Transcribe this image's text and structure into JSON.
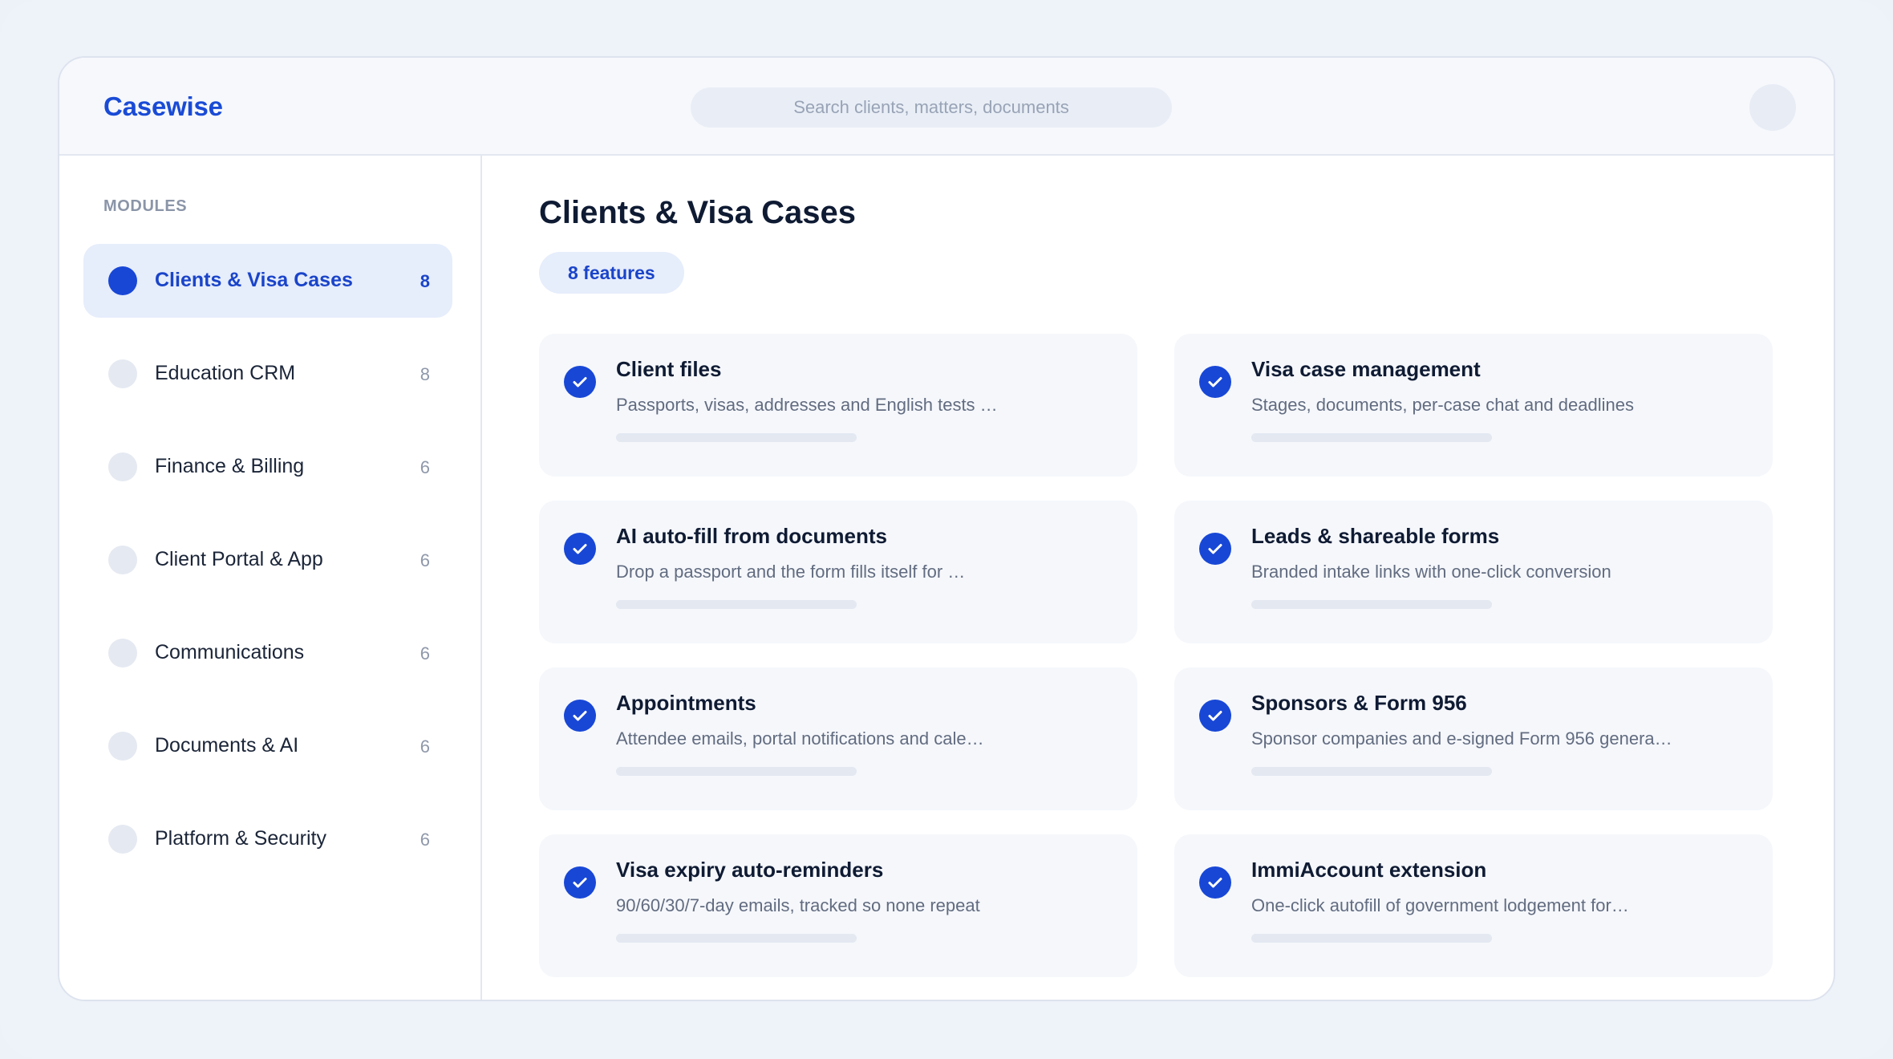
{
  "app": {
    "brand": "Casewise",
    "search_placeholder": "Search clients, matters, documents"
  },
  "sidebar": {
    "heading": "MODULES",
    "items": [
      {
        "label": "Clients & Visa Cases",
        "count": "8",
        "active": true
      },
      {
        "label": "Education CRM",
        "count": "8",
        "active": false
      },
      {
        "label": "Finance & Billing",
        "count": "6",
        "active": false
      },
      {
        "label": "Client Portal & App",
        "count": "6",
        "active": false
      },
      {
        "label": "Communications",
        "count": "6",
        "active": false
      },
      {
        "label": "Documents & AI",
        "count": "6",
        "active": false
      },
      {
        "label": "Platform & Security",
        "count": "6",
        "active": false
      }
    ]
  },
  "main": {
    "title": "Clients & Visa Cases",
    "badge": "8 features",
    "features": [
      {
        "title": "Client files",
        "desc": "Passports, visas, addresses and English tests …",
        "checked": true
      },
      {
        "title": "Visa case management",
        "desc": "Stages, documents, per-case chat and deadlines",
        "checked": true
      },
      {
        "title": "AI auto-fill from documents",
        "desc": "Drop a passport and the form fills itself for …",
        "checked": true
      },
      {
        "title": "Leads & shareable forms",
        "desc": "Branded intake links with one-click conversion",
        "checked": true
      },
      {
        "title": "Appointments",
        "desc": "Attendee emails, portal notifications and cale…",
        "checked": true
      },
      {
        "title": "Sponsors & Form 956",
        "desc": "Sponsor companies and e-signed Form 956 genera…",
        "checked": true
      },
      {
        "title": "Visa expiry auto-reminders",
        "desc": "90/60/30/7-day emails, tracked so none repeat",
        "checked": true
      },
      {
        "title": "ImmiAccount extension",
        "desc": "One-click autofill of government lodgement for…",
        "checked": true
      }
    ]
  },
  "icons": {
    "feature_status": "check-circle-icon"
  },
  "colors": {
    "accent": "#1847d6",
    "background": "#eef2f9",
    "card": "#f5f7fb"
  }
}
